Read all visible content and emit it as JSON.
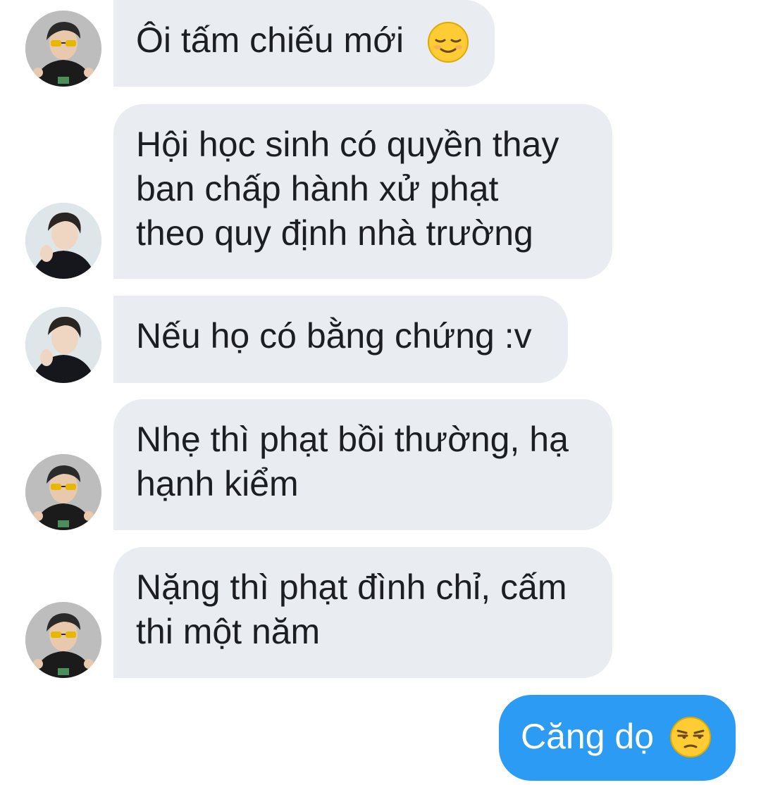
{
  "conversation": {
    "messages": [
      {
        "lines": [
          "Ôi tấm chiếu mới"
        ],
        "emoji": "relieved-face"
      },
      {
        "lines": [
          "Hội học sinh có quyền thay",
          "ban chấp hành xử phạt",
          "theo quy định nhà trường"
        ]
      },
      {
        "lines": [
          "Nếu họ có bằng chứng :v"
        ]
      },
      {
        "lines": [
          "Nhẹ thì phạt bồi thường, hạ",
          "hạnh kiểm"
        ]
      },
      {
        "lines": [
          "Nặng thì phạt đình chỉ, cấm",
          "thi một năm"
        ]
      }
    ],
    "outgoing": {
      "text": "Căng dọ",
      "emoji": "unamused-face"
    }
  },
  "colors": {
    "incoming_bubble": "#e9ecf0",
    "outgoing_bubble": "#2b9bf3",
    "incoming_text": "#1c1e21",
    "outgoing_text": "#ffffff"
  }
}
